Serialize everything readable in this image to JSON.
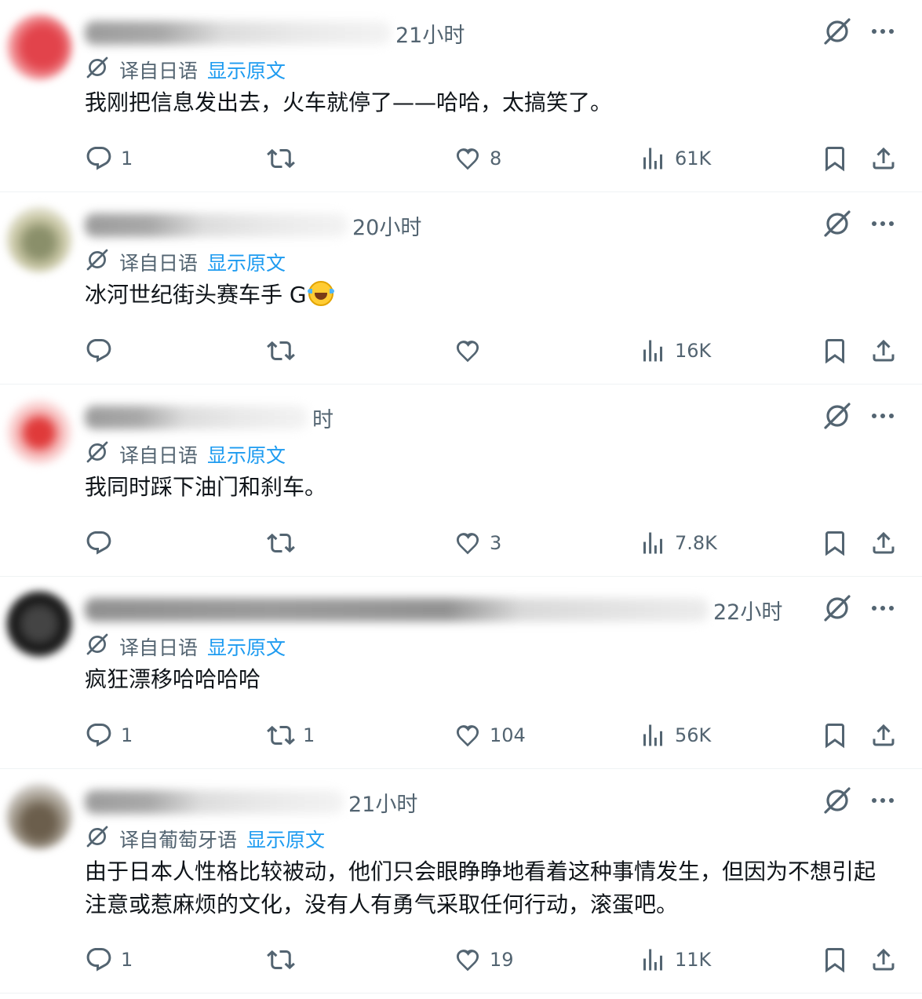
{
  "posts": [
    {
      "time": "21小时",
      "translation_label": "译自日语",
      "show_original": "显示原文",
      "text": "我刚把信息发出去，火车就停了——哈哈，太搞笑了。",
      "replies": "1",
      "retweets": "",
      "likes": "8",
      "views": "61K",
      "avatar_color": "#e2434b"
    },
    {
      "time": "20小时",
      "translation_label": "译自日语",
      "show_original": "显示原文",
      "text": "冰河世纪街头赛车手 G",
      "emoji": "rolling-on-floor-laughing",
      "replies": "",
      "retweets": "",
      "likes": "",
      "views": "16K",
      "avatar_color": "#b9b99a"
    },
    {
      "time": "时",
      "translation_label": "译自日语",
      "show_original": "显示原文",
      "text": "我同时踩下油门和刹车。",
      "replies": "",
      "retweets": "",
      "likes": "3",
      "views": "7.8K",
      "avatar_color": "#e03a3a"
    },
    {
      "time": "22小时",
      "translation_label": "译自日语",
      "show_original": "显示原文",
      "text": "疯狂漂移哈哈哈哈",
      "replies": "1",
      "retweets": "1",
      "likes": "104",
      "views": "56K",
      "avatar_color": "#222222"
    },
    {
      "time": "21小时",
      "translation_label": "译自葡萄牙语",
      "show_original": "显示原文",
      "text": "由于日本人性格比较被动，他们只会眼睁睁地看着这种事情发生，但因为不想引起注意或惹麻烦的文化，没有人有勇气采取任何行动，滚蛋吧。",
      "replies": "1",
      "retweets": "",
      "likes": "19",
      "views": "11K",
      "avatar_color": "#7a6f60"
    }
  ],
  "icons": {
    "grok": "grok-icon",
    "more": "more-icon",
    "reply": "reply-icon",
    "retweet": "retweet-icon",
    "like": "like-icon",
    "views": "views-icon",
    "bookmark": "bookmark-icon",
    "share": "share-icon"
  },
  "colors": {
    "link": "#1d9bf0",
    "muted": "#536471",
    "text": "#0f1419",
    "divider": "#eff3f4"
  }
}
